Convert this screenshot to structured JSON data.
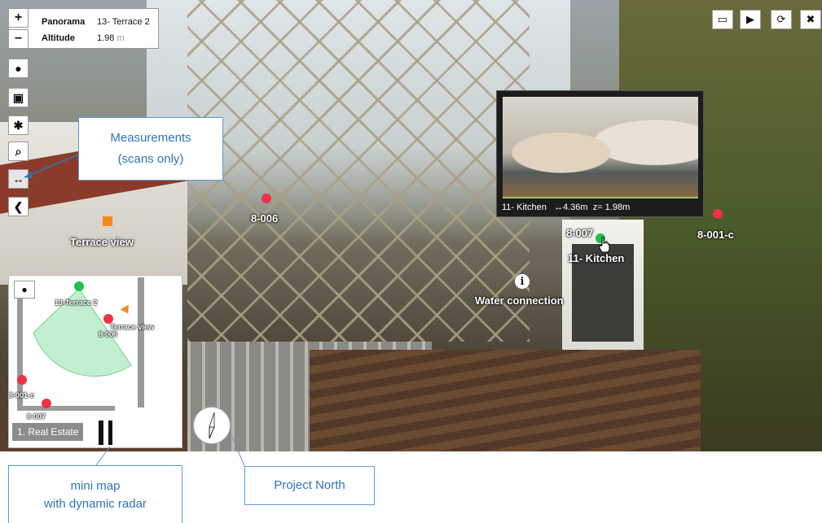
{
  "info": {
    "panorama_label": "Panorama",
    "panorama_value": "13- Terrace 2",
    "altitude_label": "Altitude",
    "altitude_value": "1.98",
    "altitude_unit": "m"
  },
  "controls": {
    "zoom_in": "+",
    "zoom_out": "−",
    "comment_icon": "speech-bubble-icon",
    "model_icon": "cube-pencil-icon",
    "settings_icon": "gear-icon",
    "search_icon": "magnifier-icon",
    "measure_icon": "arrows-horizontal-icon",
    "collapse_icon": "chevron-left-icon",
    "comment_glyph": "●",
    "model_glyph": "▣",
    "settings_glyph": "✱",
    "search_glyph": "⌕",
    "measure_glyph": "↔",
    "collapse_glyph": "❮"
  },
  "top_right": {
    "screen_glyph": "▭",
    "play_glyph": "▶",
    "refresh_glyph": "⟳",
    "close_glyph": "✖"
  },
  "hotspots": {
    "terrace_view": "Terrace view",
    "h_8_006": "8-006",
    "h_8_007": "8-007",
    "h_11_kitchen": "11- Kitchen",
    "h_8_001_c": "8-001-c",
    "water": "Water connection",
    "info_glyph": "i"
  },
  "preview": {
    "name": "11- Kitchen",
    "distance": "↔4.36m",
    "z": "z= 1.98m"
  },
  "minimap": {
    "comment_glyph": "●",
    "label_terrace2": "13-Terrace 2",
    "label_terrace_view": "Terrace view",
    "label_8006": "8-006",
    "label_8001c": "8-001-c",
    "label_8007": "8-007",
    "footer": "1. Real Estate"
  },
  "callouts": {
    "measurements_line1": "Measurements",
    "measurements_line2": "(scans only)",
    "minimap_line1": "mini map",
    "minimap_line2": "with dynamic radar",
    "north": "Project North"
  },
  "colors": {
    "callout_border": "#5b9bd5",
    "callout_text": "#2e75b6",
    "hotspot_red": "#ee3344",
    "hotspot_green": "#1fbf4a",
    "hotspot_orange": "#f28a1c"
  }
}
